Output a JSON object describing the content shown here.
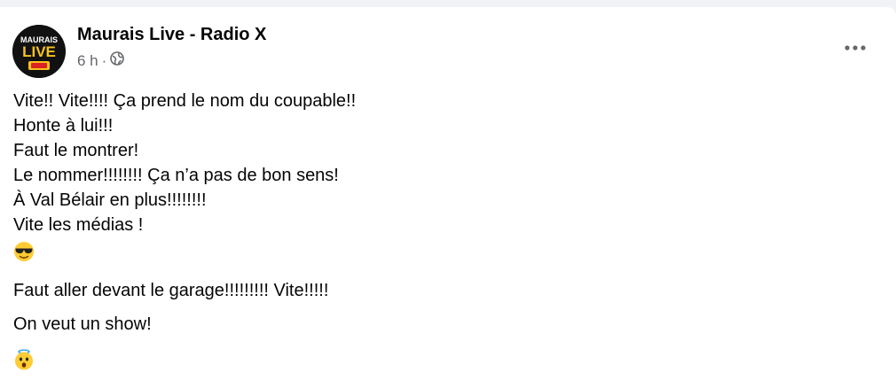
{
  "post": {
    "author": "Maurais Live - Radio X",
    "avatar_text": [
      "MAURAIS",
      "LIVE"
    ],
    "time": "6 h",
    "separator": "·",
    "privacy_icon": "globe-icon",
    "more_icon": "more-options-icon",
    "lines": [
      "Vite!! Vite!!!! Ça prend le nom du coupable!!",
      "Honte à lui!!!",
      "Faut le montrer!",
      "Le nommer!!!!!!!! Ça n’a pas de bon sens!",
      "À Val Bélair en plus!!!!!!!!",
      "Vite les médias !"
    ],
    "emoji_1": "sunglasses-emoji",
    "line_garage": "Faut aller devant le garage!!!!!!!!! Vite!!!!!",
    "line_show": "On veut un show!",
    "emoji_2": "astonished-angel-emoji"
  },
  "colors": {
    "text_primary": "#050505",
    "text_secondary": "#65676b",
    "emoji_yellow": "#ffcc33"
  }
}
